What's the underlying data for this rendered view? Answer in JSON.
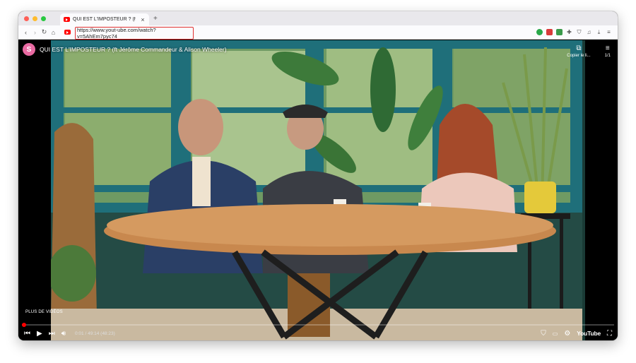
{
  "browser": {
    "tab_title": "QUI EST L'IMPOSTEUR ? (f",
    "tab_close": "×",
    "new_tab": "+",
    "url": "https://www.yout-ube.com/watch?v=5AhEm7pyc74"
  },
  "colors": {
    "highlight": "#e03030",
    "progress": "#ff0000",
    "channel": "#e96aa2"
  },
  "video": {
    "title": "QUI EST L'IMPOSTEUR ? (ft Jérôme Commandeur & Alison Wheeler)",
    "channel_initial": "S",
    "copy_link": "Copier le li...",
    "playlist_count": "1/1",
    "more_videos": "PLUS DE VIDÉOS",
    "time": "0:01 / 49:14 (48:23)",
    "progress": 0.0003,
    "brand": "YouTube"
  }
}
